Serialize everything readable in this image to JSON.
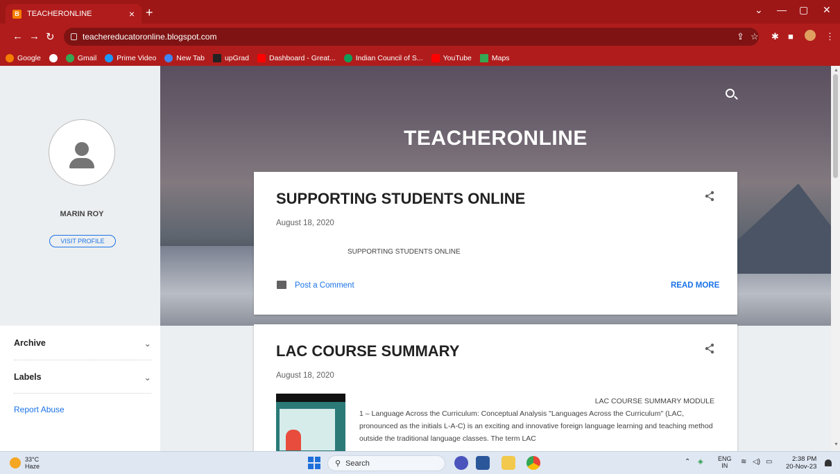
{
  "browser": {
    "tab_title": "TEACHERONLINE",
    "tab_close": "×",
    "new_tab": "+",
    "url": "teachereducatoronline.blogspot.com",
    "bookmarks": [
      {
        "label": "Google",
        "color": "#f57d00"
      },
      {
        "label": "",
        "color": "#555555"
      },
      {
        "label": "Gmail",
        "color": "#34a853"
      },
      {
        "label": "Prime Video",
        "color": "#1a98ff"
      },
      {
        "label": "New Tab",
        "color": "#4285f4"
      },
      {
        "label": "upGrad",
        "color": "#222222"
      },
      {
        "label": "Dashboard - Great...",
        "color": "#ff0000"
      },
      {
        "label": "Indian Council of S...",
        "color": "#0f9d58"
      },
      {
        "label": "YouTube",
        "color": "#ff0000"
      },
      {
        "label": "Maps",
        "color": "#34a853"
      }
    ]
  },
  "sidebar": {
    "author_name": "MARIN ROY",
    "visit_profile": "VISIT PROFILE",
    "archive": "Archive",
    "labels": "Labels",
    "report_abuse": "Report Abuse"
  },
  "hero": {
    "title": "TEACHERONLINE"
  },
  "posts": [
    {
      "title": "SUPPORTING STUDENTS ONLINE",
      "date": "August 18, 2020",
      "snippet": "SUPPORTING STUDENTS ONLINE",
      "comment": "Post a Comment",
      "read_more": "READ MORE"
    },
    {
      "title": "LAC COURSE SUMMARY",
      "date": "August 18, 2020",
      "excerpt_head": "LAC COURSE SUMMARY      MODULE",
      "excerpt": "1 – Language Across the  Curriculum: Conceptual Analysis            \"Languages Across the Curriculum\" (LAC, pronounced as the initials L-A-C)    is  an exciting and  innovative foreign language learning and teaching method  outside the traditional language classes. The term  LAC"
    }
  ],
  "taskbar": {
    "temp": "33°C",
    "weather": "Haze",
    "search": "Search",
    "lang1": "ENG",
    "lang2": "IN",
    "time": "2:38 PM",
    "date": "20-Nov-23"
  }
}
